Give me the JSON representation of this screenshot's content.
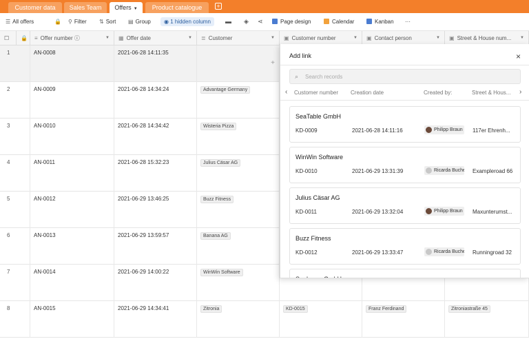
{
  "tabs": [
    {
      "label": "Customer data",
      "active": false
    },
    {
      "label": "Sales Team",
      "active": false
    },
    {
      "label": "Offers",
      "active": true
    },
    {
      "label": "Product catalogue",
      "active": false
    }
  ],
  "toolbar": {
    "all_offers": "All offers",
    "filter": "Filter",
    "sort": "Sort",
    "group": "Group",
    "hidden_column": "1 hidden column",
    "page_design": "Page design",
    "calendar": "Calendar",
    "kanban": "Kanban",
    "more": "···"
  },
  "columns": [
    "Offer number",
    "Offer date",
    "Customer",
    "Customer number",
    "Contact person",
    "Street & House num..."
  ],
  "rows": [
    {
      "n": "1",
      "offer": "AN-0008",
      "date": "2021-06-28 14:11:35",
      "customer": "",
      "custnum": "",
      "contact": "",
      "street": ""
    },
    {
      "n": "2",
      "offer": "AN-0009",
      "date": "2021-06-28 14:34:24",
      "customer": "Advantage Germany",
      "custnum": "",
      "contact": "",
      "street": ""
    },
    {
      "n": "3",
      "offer": "AN-0010",
      "date": "2021-06-28 14:34:42",
      "customer": "Wisteria Pizza",
      "custnum": "",
      "contact": "",
      "street": ""
    },
    {
      "n": "4",
      "offer": "AN-0011",
      "date": "2021-06-28 15:32:23",
      "customer": "Julius Cäsar AG",
      "custnum": "",
      "contact": "",
      "street": ""
    },
    {
      "n": "5",
      "offer": "AN-0012",
      "date": "2021-06-29 13:46:25",
      "customer": "Buzz Fitness",
      "custnum": "",
      "contact": "",
      "street": ""
    },
    {
      "n": "6",
      "offer": "AN-0013",
      "date": "2021-06-29 13:59:57",
      "customer": "Banana AG",
      "custnum": "",
      "contact": "",
      "street": ""
    },
    {
      "n": "7",
      "offer": "AN-0014",
      "date": "2021-06-29 14:00:22",
      "customer": "WinWin Software",
      "custnum": "",
      "contact": "",
      "street": ""
    },
    {
      "n": "8",
      "offer": "AN-0015",
      "date": "2021-06-29 14:34:41",
      "customer": "Zitronia",
      "custnum": "KD-0015",
      "contact": "Franz Ferdinand",
      "street": "Zitroniastraße 45"
    }
  ],
  "modal": {
    "title": "Add link",
    "close": "×",
    "search_placeholder": "Search records",
    "headers": [
      "Customer number",
      "Creation date",
      "Created by:",
      "Street & Hous..."
    ],
    "prev": "‹",
    "next": "›",
    "records": [
      {
        "title": "SeaTable GmbH",
        "num": "KD-0009",
        "date": "2021-06-28 14:11:16",
        "creator": "Philipp Braun",
        "street": "117er Ehrenh..."
      },
      {
        "title": "WinWin Software",
        "num": "KD-0010",
        "date": "2021-06-29 13:31:39",
        "creator": "Ricarda Buche",
        "street": "Exampleroad 66"
      },
      {
        "title": "Julius Cäsar AG",
        "num": "KD-0011",
        "date": "2021-06-29 13:32:04",
        "creator": "Philipp Braun",
        "street": "Maxunterumst..."
      },
      {
        "title": "Buzz Fitness",
        "num": "KD-0012",
        "date": "2021-06-29 13:33:47",
        "creator": "Ricarda Buche",
        "street": "Runningroad 32"
      },
      {
        "title": "Sunbeam GmbH",
        "num": "",
        "date": "",
        "creator": "",
        "street": ""
      }
    ]
  },
  "colors": {
    "accent": "#f37f2a",
    "link_blue": "#2d5f9e"
  }
}
